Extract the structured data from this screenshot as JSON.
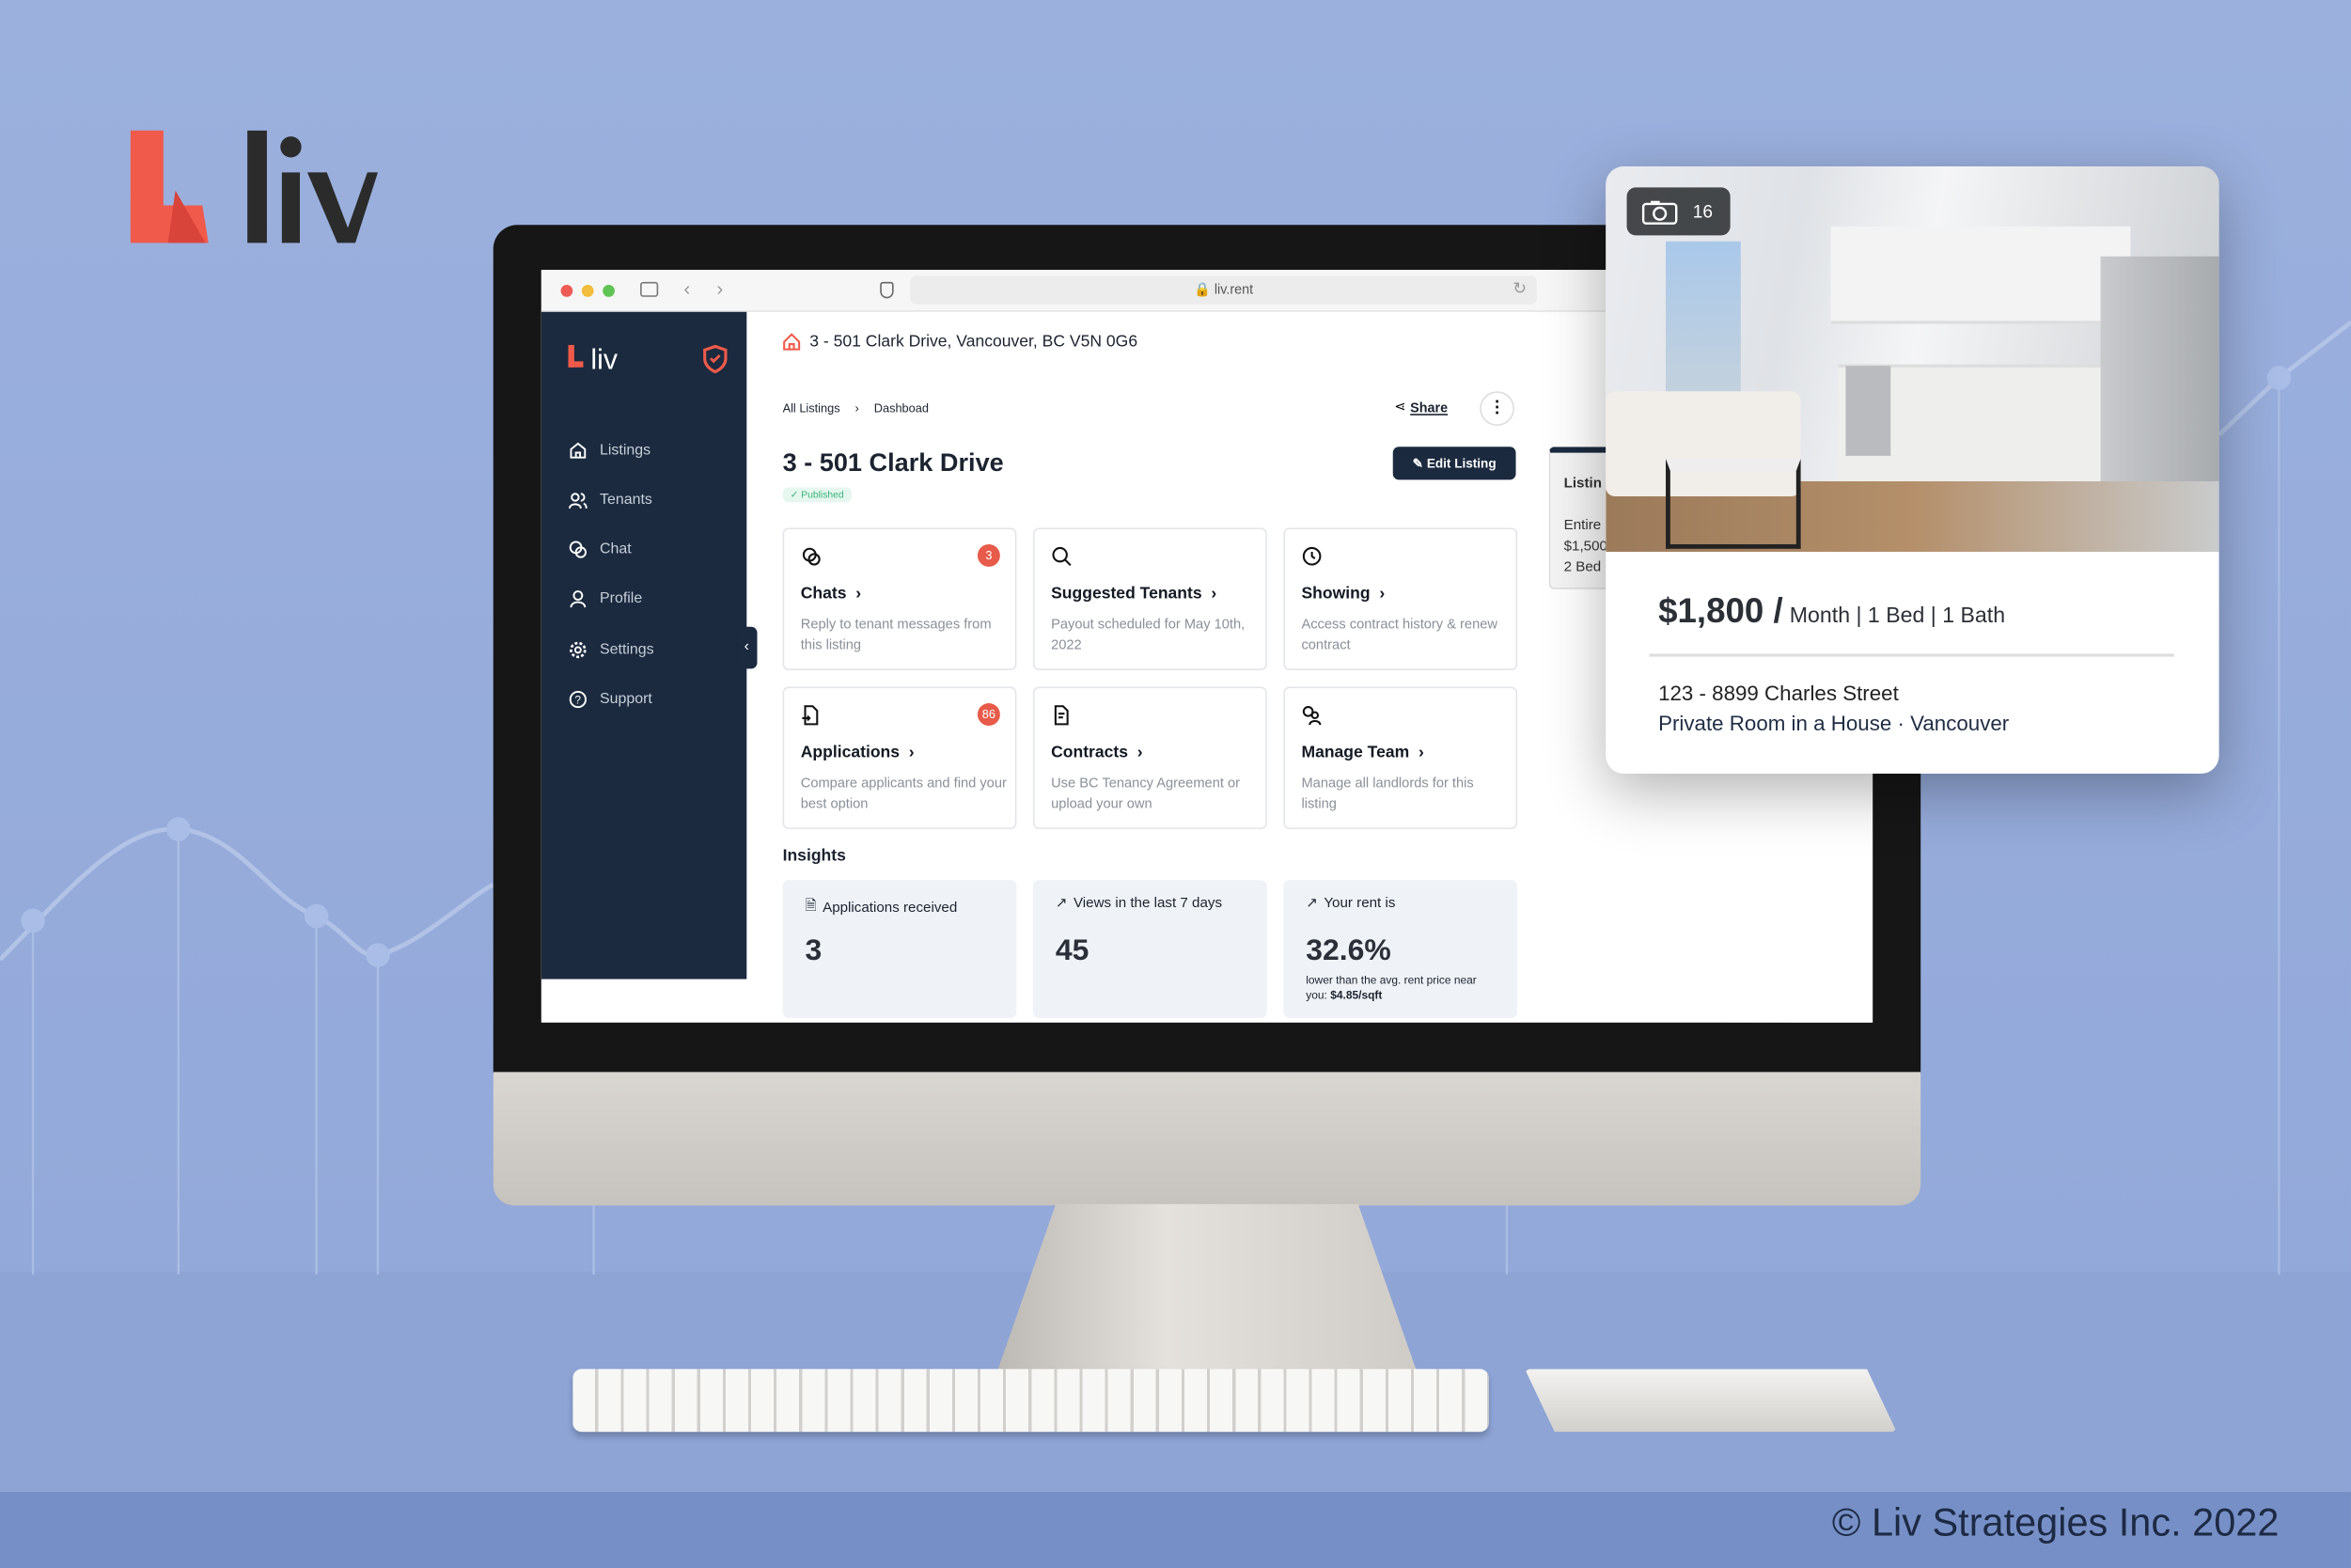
{
  "brand": {
    "name": "liv",
    "accent": "#f05a4a",
    "navy": "#1b2a3f"
  },
  "browser": {
    "url": "liv.rent"
  },
  "sidebar": {
    "items": [
      {
        "label": "Listings",
        "icon": "home-icon"
      },
      {
        "label": "Tenants",
        "icon": "users-icon"
      },
      {
        "label": "Chat",
        "icon": "chat-icon"
      },
      {
        "label": "Profile",
        "icon": "user-icon"
      },
      {
        "label": "Settings",
        "icon": "gear-icon"
      },
      {
        "label": "Support",
        "icon": "help-icon"
      }
    ]
  },
  "header": {
    "address": "3 - 501 Clark Drive, Vancouver, BC V5N 0G6"
  },
  "breadcrumb": [
    "All Listings",
    "Dashboad"
  ],
  "share_label": "Share",
  "page_title": "3 - 501 Clark Drive",
  "status": "Published",
  "edit_label": "Edit Listing",
  "cards": [
    {
      "title": "Chats",
      "desc": "Reply to tenant messages from this listing",
      "badge": "3",
      "icon": "chat-icon"
    },
    {
      "title": "Suggested Tenants",
      "desc": "Payout scheduled for May 10th, 2022",
      "icon": "search-icon"
    },
    {
      "title": "Showing",
      "desc": "Access contract history & renew contract",
      "icon": "clock-icon"
    },
    {
      "title": "Applications",
      "desc": "Compare applicants and find your best option",
      "badge": "86",
      "icon": "file-import-icon"
    },
    {
      "title": "Contracts",
      "desc": "Use BC Tenancy Agreement or upload your own",
      "icon": "contract-icon"
    },
    {
      "title": "Manage Team",
      "desc": "Manage all landlords for this listing",
      "icon": "team-gear-icon"
    }
  ],
  "insights": {
    "title": "Insights",
    "items": [
      {
        "label": "Applications received",
        "value": "3"
      },
      {
        "label": "Views in the last 7 days",
        "value": "45"
      },
      {
        "label": "Your rent is",
        "value": "32.6%",
        "note": "lower than the avg. rent price near you: ",
        "note_bold": "$4.85/sqft"
      }
    ]
  },
  "behind_card": {
    "title": "Listin",
    "line1": "Entire",
    "line2": "$1,500",
    "line3": "2 Bed"
  },
  "listing_card": {
    "photo_count": "16",
    "price": "$1,800 /",
    "details": "Month | 1 Bed | 1 Bath",
    "address": "123 - 8899 Charles Street",
    "type": "Private Room in a House · Vancouver"
  },
  "copyright": "© Liv Strategies Inc. 2022"
}
